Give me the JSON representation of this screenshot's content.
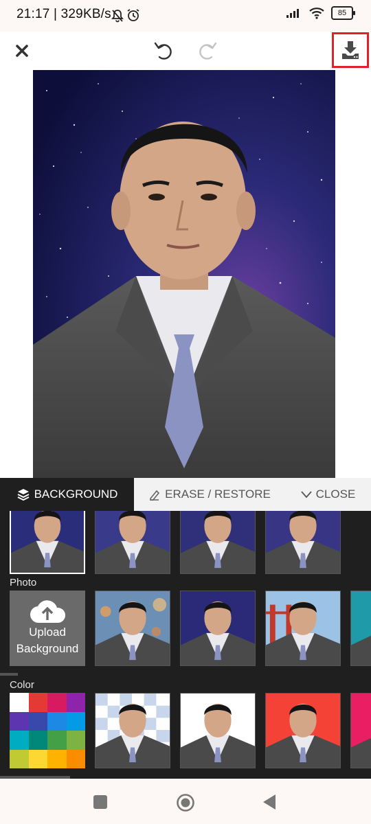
{
  "status_bar": {
    "time_text": "21:17 | 329KB/s",
    "battery": "85"
  },
  "toolbar": {
    "close_icon": "close-icon",
    "undo_icon": "undo-icon",
    "redo_icon": "redo-icon",
    "download_icon": "download-icon",
    "highlight_color": "#e0202a"
  },
  "tabs": [
    {
      "label": "BACKGROUND",
      "icon": "layers-icon",
      "active": true
    },
    {
      "label": "ERASE / RESTORE",
      "icon": "eraser-icon",
      "active": false
    },
    {
      "label": "CLOSE",
      "icon": "chevron-down-icon",
      "active": false
    }
  ],
  "sections": {
    "photo_label": "Photo",
    "upload_label_line1": "Upload",
    "upload_label_line2": "Background",
    "color_label": "Color"
  },
  "colors": {
    "panel_bg": "#1f1f1f",
    "palette": [
      "#ffffff",
      "#e53935",
      "#d81b60",
      "#8e24aa",
      "#5e35b1",
      "#3949ab",
      "#1e88e5",
      "#039be5",
      "#00acc1",
      "#00897b",
      "#43a047",
      "#7cb342",
      "#c0ca33",
      "#fdd835",
      "#ffb300",
      "#fb8c00"
    ],
    "solid_bgs": [
      "#ffffff",
      "#f44336",
      "#e91e63"
    ]
  },
  "navbar": {
    "icons": [
      "square-icon",
      "circle-icon",
      "triangle-back-icon"
    ]
  }
}
